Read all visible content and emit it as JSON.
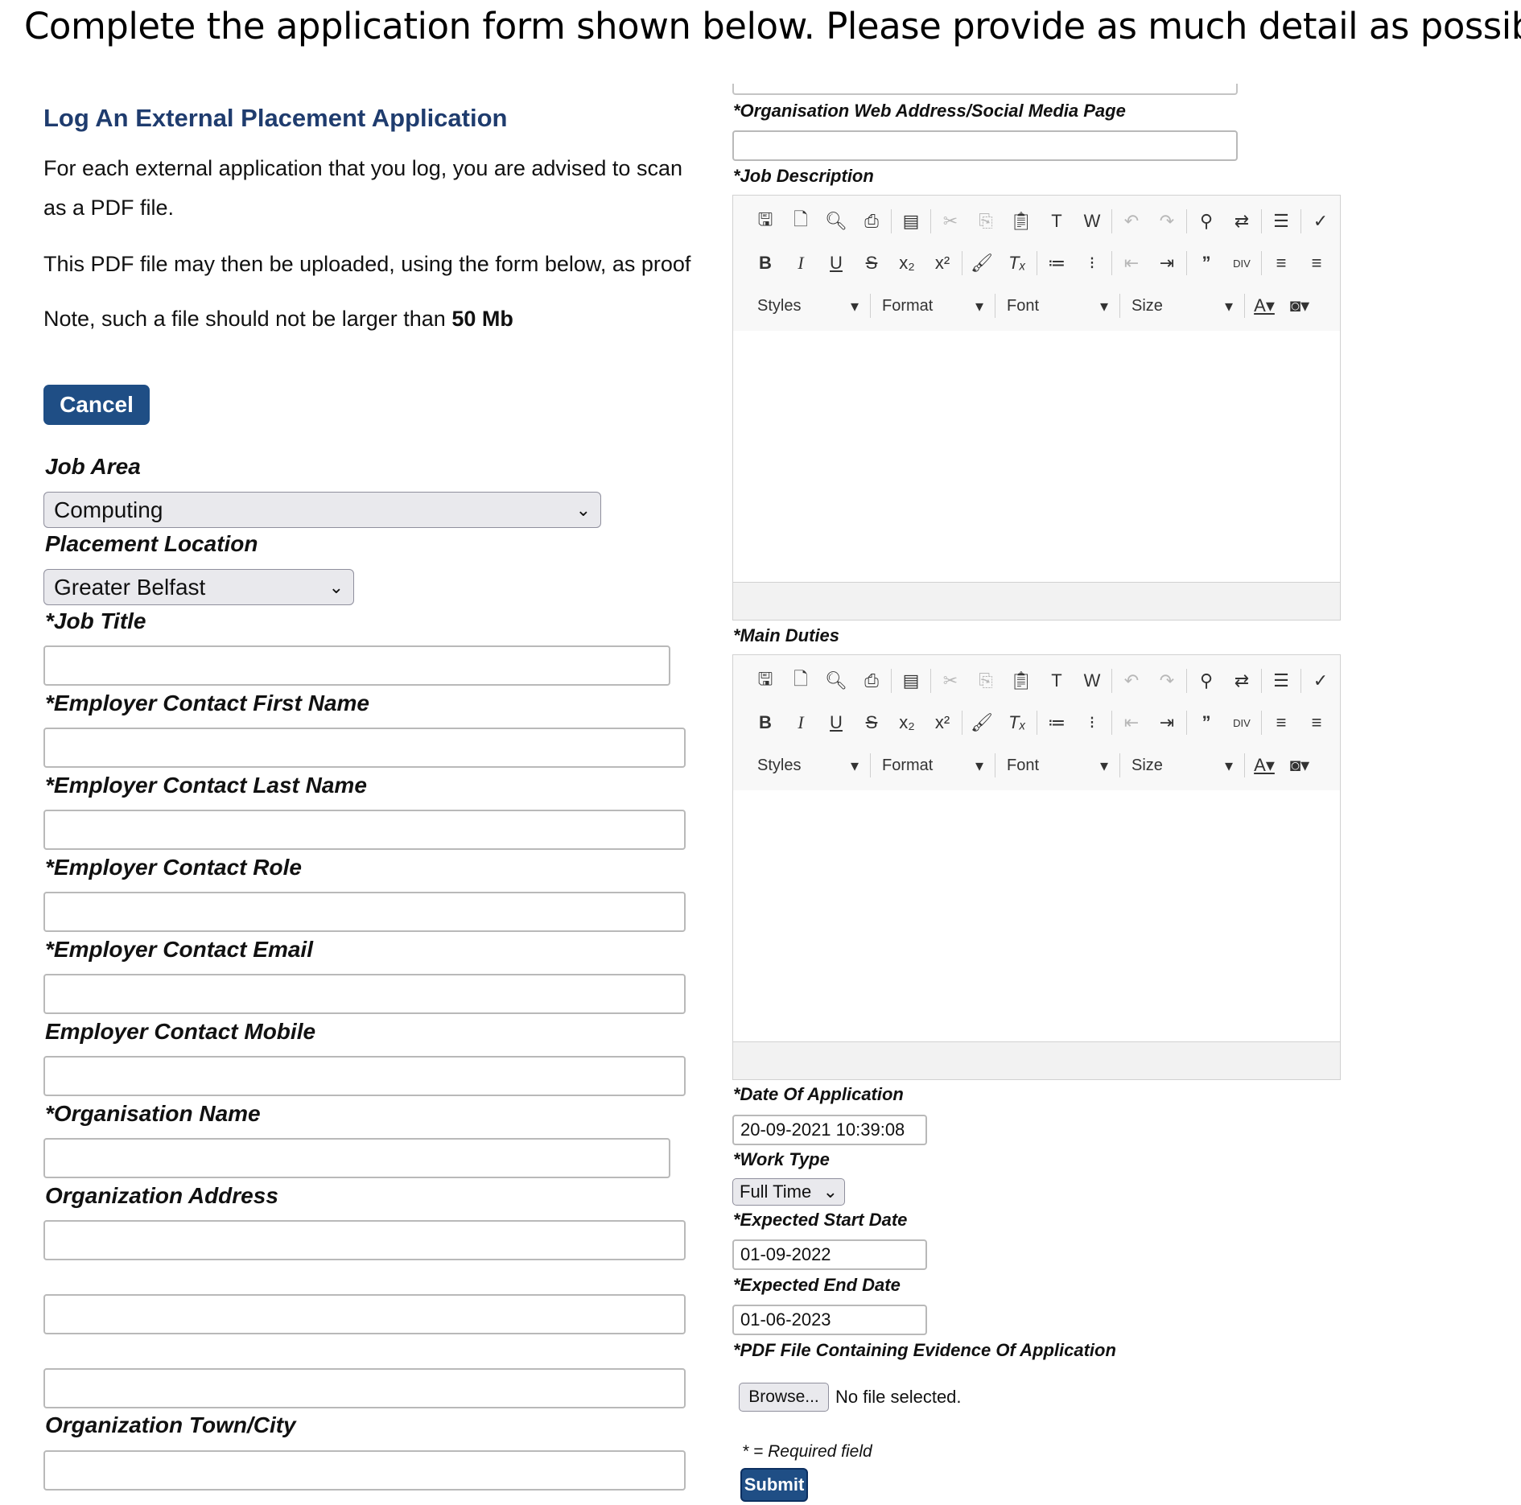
{
  "instruction": "Complete the application form shown below. Please provide as much detail as possible.",
  "form": {
    "title": "Log An External Placement Application",
    "intro_line1": "For each external application that you log, you are advised to scan",
    "intro_line2": "as a PDF file.",
    "intro_line3": "This PDF file may then be uploaded, using the form below, as proof",
    "note_prefix": "Note, such a file should not be larger than ",
    "note_size": "50 Mb",
    "cancel_label": "Cancel",
    "submit_label": "Submit",
    "required_note": "* = Required field"
  },
  "fields": {
    "job_area": {
      "label": "Job Area",
      "value": "Computing"
    },
    "placement_location": {
      "label": "Placement Location",
      "value": "Greater Belfast"
    },
    "job_title": {
      "label": "*Job Title",
      "value": ""
    },
    "contact_first_name": {
      "label": "*Employer Contact First Name",
      "value": ""
    },
    "contact_last_name": {
      "label": "*Employer Contact Last Name",
      "value": ""
    },
    "contact_role": {
      "label": "*Employer Contact Role",
      "value": ""
    },
    "contact_email": {
      "label": "*Employer Contact Email",
      "value": ""
    },
    "contact_mobile": {
      "label": "Employer Contact Mobile",
      "value": ""
    },
    "organisation_name": {
      "label": "*Organisation Name",
      "value": ""
    },
    "organization_address": {
      "label": "Organization Address",
      "line1": "",
      "line2": "",
      "line3": ""
    },
    "organization_town": {
      "label": "Organization Town/City",
      "value": ""
    },
    "organisation_web": {
      "label": "*Organisation Web Address/Social Media Page",
      "value": ""
    },
    "job_description": {
      "label": "*Job Description",
      "value": ""
    },
    "main_duties": {
      "label": "*Main Duties",
      "value": ""
    },
    "date_of_application": {
      "label": "*Date Of Application",
      "value": "20-09-2021 10:39:08"
    },
    "work_type": {
      "label": "*Work Type",
      "value": "Full Time"
    },
    "expected_start": {
      "label": "*Expected Start Date",
      "value": "01-09-2022"
    },
    "expected_end": {
      "label": "*Expected End Date",
      "value": "01-06-2023"
    },
    "pdf_file": {
      "label": "*PDF File Containing Evidence Of Application",
      "browse_label": "Browse...",
      "status": "No file selected."
    }
  },
  "editor_toolbar": {
    "combos": {
      "styles": "Styles",
      "format": "Format",
      "font": "Font",
      "size": "Size"
    }
  }
}
